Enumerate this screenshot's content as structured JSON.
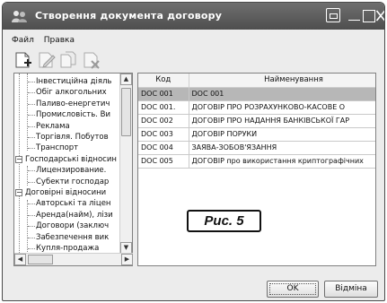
{
  "window": {
    "title": "Створення документа договору"
  },
  "menu": [
    "Файл",
    "Правка"
  ],
  "toolbar": [
    {
      "name": "add-icon",
      "enabled": true
    },
    {
      "name": "edit-icon",
      "enabled": false
    },
    {
      "name": "copy-icon",
      "enabled": false
    },
    {
      "name": "delete-icon",
      "enabled": false
    }
  ],
  "tree": {
    "items": [
      {
        "label": "Інвестиційна діяль",
        "level": 1
      },
      {
        "label": "Обіг алкогольних",
        "level": 1
      },
      {
        "label": "Паливо-енергетич",
        "level": 1
      },
      {
        "label": "Промисловість. Ви",
        "level": 1
      },
      {
        "label": "Реклама",
        "level": 1
      },
      {
        "label": "Торгівля. Побутов",
        "level": 1
      },
      {
        "label": "Транспорт",
        "level": 1
      },
      {
        "label": "Господарські відносин",
        "level": 0
      },
      {
        "label": "Лицензирование.",
        "level": 1
      },
      {
        "label": "Субекти господар",
        "level": 1
      },
      {
        "label": "Договірні відносини",
        "level": 0
      },
      {
        "label": "Авторські та ліцен",
        "level": 1
      },
      {
        "label": "Аренда(найм), лізи",
        "level": 1
      },
      {
        "label": "Договори (заключ",
        "level": 1
      },
      {
        "label": "Забезпечення вик",
        "level": 1
      },
      {
        "label": "Купля-продажа",
        "level": 1
      }
    ]
  },
  "grid": {
    "columns": [
      "Код",
      "Найменування"
    ],
    "rows": [
      {
        "code": "DOC 001",
        "name": "DOC 001",
        "selected": true
      },
      {
        "code": "DOC 001.",
        "name": "ДОГОВІР ПРО РОЗРАХУНКОВО-КАСОВЕ О",
        "selected": false
      },
      {
        "code": "DOC 002",
        "name": "ДОГОВІР ПРО НАДАННЯ БАНКІВСЬКОЇ ГАР",
        "selected": false
      },
      {
        "code": "DOC 003",
        "name": "ДОГОВІР ПОРУКИ",
        "selected": false
      },
      {
        "code": "DOC 004",
        "name": "ЗАЯВА-ЗОБОВ'ЯЗАННЯ",
        "selected": false
      },
      {
        "code": "DOC 005",
        "name": "ДОГОВІР про використання криптографічних",
        "selected": false
      }
    ]
  },
  "figure_label": "Рис. 5",
  "buttons": {
    "ok": "OK",
    "cancel": "Відміна"
  }
}
